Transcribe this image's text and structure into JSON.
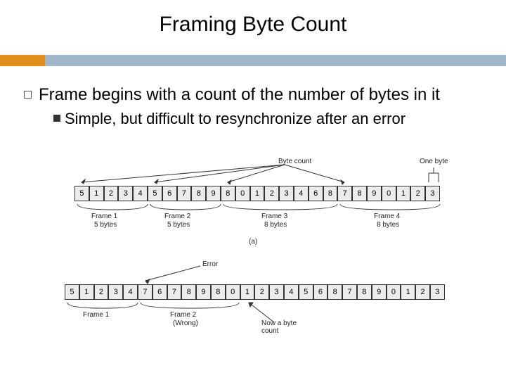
{
  "title": "Framing Byte Count",
  "bullet_main": "Frame begins with a count of the number of bytes in it",
  "bullet_sub": "Simple, but difficult to resynchronize after an error",
  "labels": {
    "byte_count": "Byte count",
    "one_byte": "One byte",
    "error": "Error",
    "now_byte": "Now a byte count",
    "part_a": "(a)"
  },
  "frames": {
    "f1": {
      "name": "Frame 1",
      "sub": "5 bytes"
    },
    "f2": {
      "name": "Frame 2",
      "sub": "5 bytes"
    },
    "f3": {
      "name": "Frame 3",
      "sub": "8 bytes"
    },
    "f4": {
      "name": "Frame 4",
      "sub": "8 bytes"
    },
    "f1b": {
      "name": "Frame 1",
      "sub": ""
    },
    "f2b": {
      "name": "Frame 2",
      "sub": "(Wrong)"
    }
  },
  "chart_data": {
    "type": "table",
    "stream_a": [
      "5",
      "1",
      "2",
      "3",
      "4",
      "5",
      "6",
      "7",
      "8",
      "9",
      "8",
      "0",
      "1",
      "2",
      "3",
      "4",
      "6",
      "8",
      "7",
      "8",
      "9",
      "0",
      "1",
      "2",
      "3"
    ],
    "stream_b": [
      "5",
      "1",
      "2",
      "3",
      "4",
      "7",
      "6",
      "7",
      "8",
      "9",
      "8",
      "0",
      "1",
      "2",
      "3",
      "4",
      "5",
      "6",
      "8",
      "7",
      "8",
      "9",
      "0",
      "1",
      "2",
      "3"
    ],
    "frames_a": [
      {
        "label": "Frame 1",
        "bytes": 5,
        "start": 0
      },
      {
        "label": "Frame 2",
        "bytes": 5,
        "start": 5
      },
      {
        "label": "Frame 3",
        "bytes": 8,
        "start": 10
      },
      {
        "label": "Frame 4",
        "bytes": 8,
        "start": 18
      }
    ],
    "frames_b": [
      {
        "label": "Frame 1",
        "bytes": 5,
        "start": 0
      },
      {
        "label": "Frame 2 (Wrong)",
        "bytes": 7,
        "start": 5
      }
    ],
    "error_index_b": 5,
    "annotations": [
      "Byte count",
      "One byte",
      "Error",
      "Now a byte count",
      "(a)"
    ]
  }
}
